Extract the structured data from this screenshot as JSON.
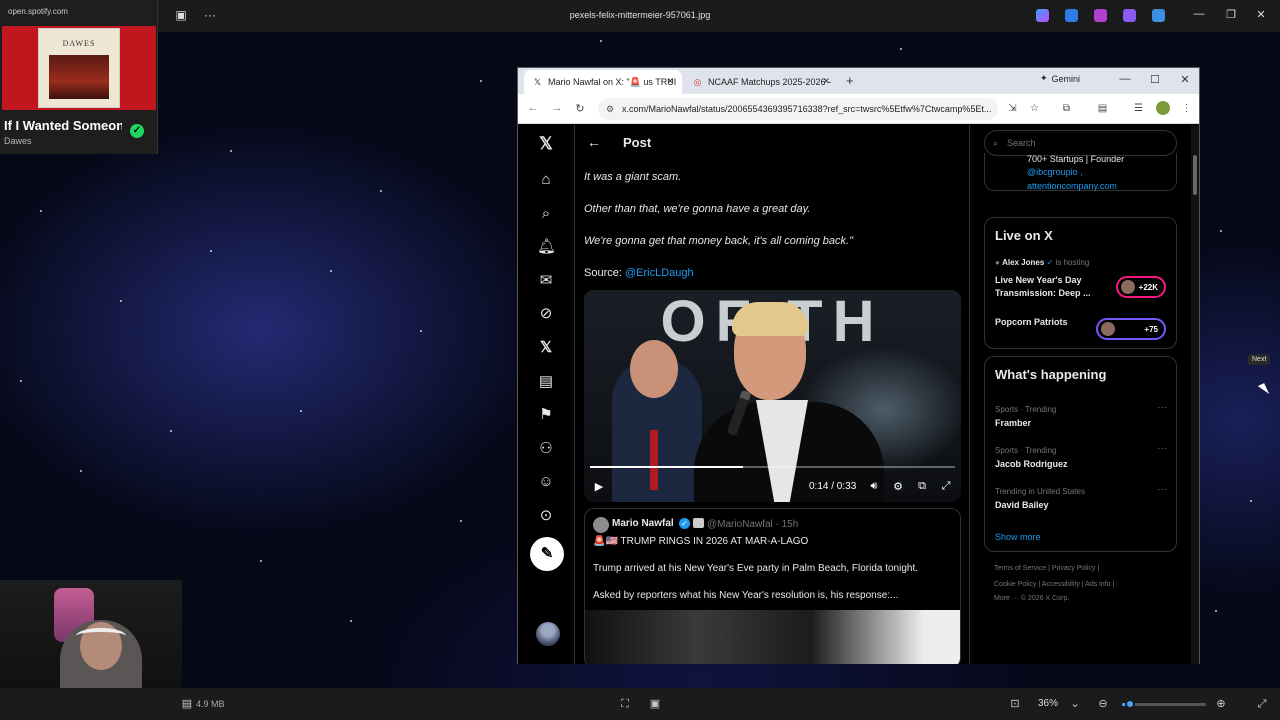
{
  "viewer": {
    "title": "pexels-felix-mittermeier-957061.jpg",
    "file_size": "4.9 MB",
    "zoom": "36%",
    "zoom_fraction": 0.1
  },
  "spotify": {
    "url": "open.spotify.com",
    "album_text": "DAWES",
    "song": "If I Wanted Someone",
    "artist": "Dawes"
  },
  "browser": {
    "tabs": [
      {
        "label": "Mario Nawfal on X: \"🚨 us TRUI",
        "icon": "x-logo-icon"
      },
      {
        "label": "NCAAF Matchups 2025-2026 -",
        "icon": "chrome-tab-icon"
      }
    ],
    "gemini_label": "Gemini",
    "url": "x.com/MarioNawfal/status/2006554369395716338?ref_src=twsrc%5Etfw%7Ctwcamp%5Et..."
  },
  "post": {
    "header": "Post",
    "lines": [
      "It was a giant scam.",
      "Other than that, we're gonna have a great day.",
      "We're gonna get that money back, it's all coming back.\""
    ],
    "source_label": "Source: ",
    "source_handle": "@EricLDaugh",
    "video": {
      "overlay_text": "OF TH",
      "time": "0:14 / 0:33",
      "progress_fraction": 0.42
    },
    "quote": {
      "name": "Mario Nawfal",
      "handle": "@MarioNawfal · 15h",
      "headline": "🚨🇺🇸 TRUMP RINGS IN 2026 AT MAR-A-LAGO",
      "text1": "Trump arrived at his New Year's Eve party in Palm Beach, Florida tonight.",
      "text2": "Asked by reporters what his New Year's resolution is, his response:..."
    }
  },
  "sidebar": {
    "search_placeholder": "Search",
    "bio": {
      "line1": "700+ Startups | Founder",
      "line2": "@ibcgroupio ,",
      "line3": "attentioncompany.com"
    },
    "live": {
      "title": "Live on X",
      "host_name": "Alex Jones",
      "host_suffix": " is hosting",
      "items": [
        {
          "title": "Live New Year's Day Transmission: Deep ...",
          "count": "+22K"
        },
        {
          "title": "Popcorn Patriots",
          "count": "+75"
        }
      ]
    },
    "happening": {
      "title": "What's happening",
      "trends": [
        {
          "meta": "Sports · Trending",
          "name": "Framber"
        },
        {
          "meta": "Sports · Trending",
          "name": "Jacob Rodriguez"
        },
        {
          "meta": "Trending in United States",
          "name": "David Bailey"
        }
      ],
      "show_more": "Show more"
    },
    "footer": {
      "line1": "Terms of Service  |  Privacy Policy  |",
      "line2": "Cookie Policy  |  Accessibility  |  Ads info  |",
      "line3": "More ···   © 2026 X Corp."
    }
  },
  "tooltip": "Next"
}
